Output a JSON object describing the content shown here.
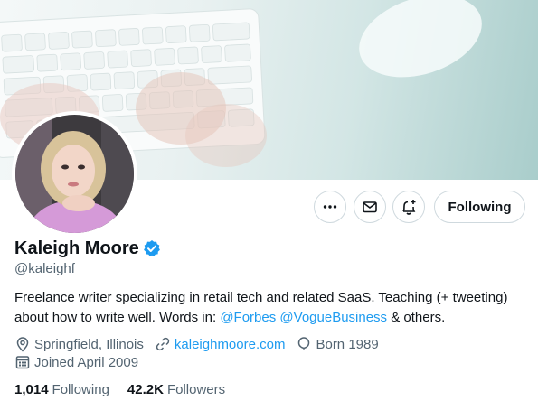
{
  "profile": {
    "display_name": "Kaleigh Moore",
    "handle": "@kaleighf",
    "bio_text": "Freelance writer specializing in retail tech and related SaaS. Teaching (+ tweeting) about how to write well. Words in: ",
    "bio_mention_1": "@Forbes",
    "bio_mention_2": "@VogueBusiness",
    "bio_tail": " & others.",
    "location": "Springfield, Illinois",
    "website": "kaleighmoore.com",
    "born": "Born 1989",
    "joined": "Joined April 2009"
  },
  "stats": {
    "following_count": "1,014",
    "following_label": "Following",
    "followers_count": "42.2K",
    "followers_label": "Followers"
  },
  "actions": {
    "following_button": "Following"
  },
  "icons": {
    "more": "more-icon",
    "message": "envelope-icon",
    "notify": "bell-plus-icon",
    "verified": "verified-badge-icon",
    "location": "location-pin-icon",
    "link": "link-icon",
    "birthday": "balloon-icon",
    "calendar": "calendar-icon"
  },
  "colors": {
    "accent": "#1d9bf0",
    "text_primary": "#0f1419",
    "text_secondary": "#536471",
    "border": "#cfd9de"
  }
}
